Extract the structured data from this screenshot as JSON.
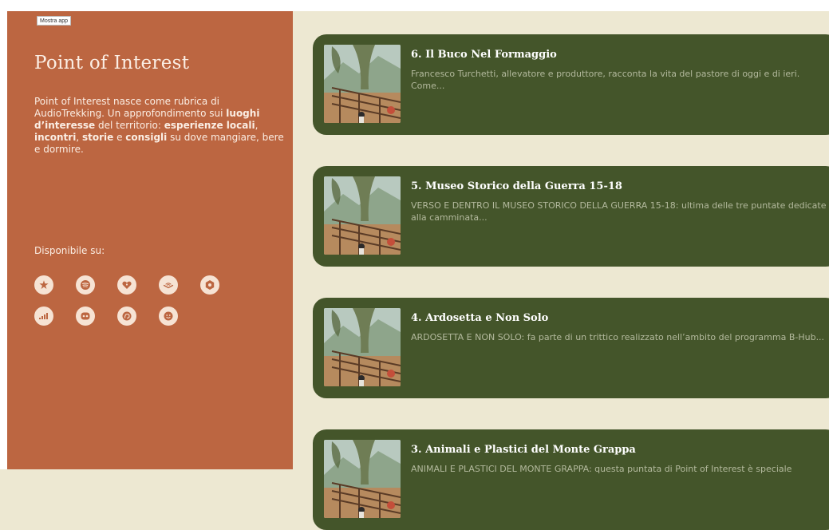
{
  "toolbar": {
    "show_app_label": "Mostra app"
  },
  "sidebar": {
    "title": "Point of Interest",
    "description_parts": [
      "Point of Interest nasce come rubrica di AudioTrekking. Un approfondimento sui ",
      "luoghi d’interesse",
      " del territorio: ",
      "esperienze locali",
      ", ",
      "incontri",
      ", ",
      "storie",
      " e ",
      "consigli",
      " su dove mangiare, bere e dormire."
    ],
    "available_label": "Disponibile su:",
    "platforms": [
      {
        "name": "apple-podcasts-icon"
      },
      {
        "name": "spotify-icon"
      },
      {
        "name": "iheartradio-icon"
      },
      {
        "name": "audible-icon"
      },
      {
        "name": "podcast-addict-icon"
      },
      {
        "name": "deezer-icon"
      },
      {
        "name": "castbox-icon"
      },
      {
        "name": "podchaser-icon"
      },
      {
        "name": "player-fm-icon"
      }
    ]
  },
  "episodes": [
    {
      "title": "6. Il Buco Nel Formaggio",
      "description": "Francesco Turchetti, allevatore e produttore, racconta la vita del pastore di oggi e di ieri. Come..."
    },
    {
      "title": "5. Museo Storico della Guerra 15-18",
      "description": "VERSO E DENTRO IL MUSEO STORICO DELLA GUERRA 15-18: ultima delle tre puntate dedicate alla camminata..."
    },
    {
      "title": "4. Ardosetta e Non Solo",
      "description": "ARDOSETTA E NON SOLO: fa parte di un trittico realizzato nell’ambito del programma B-Hub..."
    },
    {
      "title": "3. Animali e Plastici del Monte Grappa",
      "description": "ANIMALI E PLASTICI DEL MONTE GRAPPA: questa puntata di Point of Interest è speciale"
    }
  ],
  "colors": {
    "sidebar_bg": "#bc6641",
    "page_bg": "#ede8d2",
    "card_bg": "#44552a",
    "text_light": "#fbeee4",
    "card_desc": "#b3b99d"
  }
}
